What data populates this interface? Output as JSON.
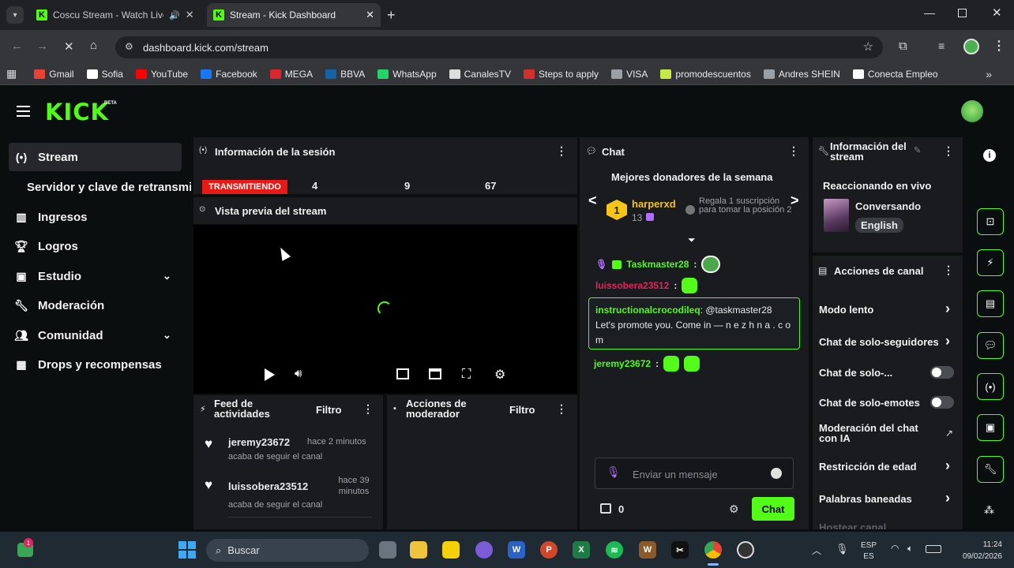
{
  "browser": {
    "tabs": [
      {
        "title": "Coscu Stream - Watch Live"
      },
      {
        "title": "Stream - Kick Dashboard"
      }
    ],
    "url": "dashboard.kick.com/stream",
    "bookmarks": [
      {
        "label": "Gmail",
        "color": "#ea4335"
      },
      {
        "label": "Sofia",
        "color": "#ffffff"
      },
      {
        "label": "YouTube",
        "color": "#ff0000"
      },
      {
        "label": "Facebook",
        "color": "#1877f2"
      },
      {
        "label": "MEGA",
        "color": "#d9272e"
      },
      {
        "label": "BBVA",
        "color": "#1464a5"
      },
      {
        "label": "WhatsApp",
        "color": "#25d366"
      },
      {
        "label": "CanalesTV",
        "color": "#dddddd"
      },
      {
        "label": "Steps to apply",
        "color": "#d32f2f"
      },
      {
        "label": "VISA",
        "color": "#9aa0a6"
      },
      {
        "label": "promodescuentos",
        "color": "#c6e94a"
      },
      {
        "label": "Andres SHEIN",
        "color": "#9aa0a6"
      },
      {
        "label": "Conecta Empleo",
        "color": "#ffffff"
      }
    ]
  },
  "brand": {
    "logo": "KICK",
    "beta": "BETA",
    "accent": "#53fc18"
  },
  "sidebar": {
    "items": [
      {
        "label": "Stream",
        "icon": "broadcast-icon"
      },
      {
        "label": "Servidor y clave de retransmisión",
        "icon": ""
      },
      {
        "label": "Ingresos",
        "icon": "chart-icon"
      },
      {
        "label": "Logros",
        "icon": "trophy-icon"
      },
      {
        "label": "Estudio",
        "icon": "studio-icon"
      },
      {
        "label": "Moderación",
        "icon": "wrench-icon"
      },
      {
        "label": "Comunidad",
        "icon": "people-icon"
      },
      {
        "label": "Drops y recompensas",
        "icon": "gift-icon"
      }
    ]
  },
  "session": {
    "title": "Información de la sesión",
    "status": "TRANSMITIENDO",
    "stats": [
      "4",
      "9",
      "67"
    ]
  },
  "preview": {
    "title": "Vista previa del stream"
  },
  "activity": {
    "title": "Feed de actividades",
    "filter": "Filtro",
    "items": [
      {
        "user": "jeremy23672",
        "time": "hace 2 minutos",
        "desc": "acaba de seguir el canal"
      },
      {
        "user": "luissobera23512",
        "time": "hace 39 minutos",
        "desc": "acaba de seguir el canal"
      }
    ]
  },
  "modactions": {
    "title": "Acciones de moderador",
    "filter": "Filtro"
  },
  "chat": {
    "title": "Chat",
    "donors_title": "Mejores donadores de la semana",
    "top_donor": {
      "rank": "1",
      "name": "harperxd",
      "count": "13",
      "hint": "Regala 1 suscripción para tomar la posición 2"
    },
    "messages": [
      {
        "user": "Taskmaster28",
        "color": "#53fc18",
        "text": ""
      },
      {
        "user": "luissobera23512",
        "color": "#e0245e",
        "text": ""
      },
      {
        "user": "instructionalcrocodileq",
        "color": "#53fc18",
        "text": "@taskmaster28 Let's promote you. Come in — n e z h n a . c o m"
      },
      {
        "user": "jeremy23672",
        "color": "#53fc18",
        "text": ""
      }
    ],
    "input_placeholder": "Enviar un mensaje",
    "points": "0",
    "send_label": "Chat"
  },
  "streaminfo": {
    "title": "Información del stream",
    "stream_title": "Reaccionando en vivo",
    "category": "Conversando",
    "language": "English"
  },
  "channel": {
    "title": "Acciones de canal",
    "items": [
      {
        "label": "Modo lento",
        "control": "chevron"
      },
      {
        "label": "Chat de solo-seguidores",
        "control": "chevron"
      },
      {
        "label": "Chat de solo-...",
        "control": "toggle"
      },
      {
        "label": "Chat de solo-emotes",
        "control": "toggle"
      },
      {
        "label": "Moderación del chat con IA",
        "control": "external"
      },
      {
        "label": "Restricción de edad",
        "control": "chevron"
      },
      {
        "label": "Palabras baneadas",
        "control": "chevron"
      },
      {
        "label": "Hostear canal",
        "control": "none"
      }
    ]
  },
  "taskbar": {
    "search": "Buscar",
    "lang": "ESP",
    "region": "ES",
    "time": "11:24",
    "date": "09/02/2026",
    "notif": "1"
  }
}
